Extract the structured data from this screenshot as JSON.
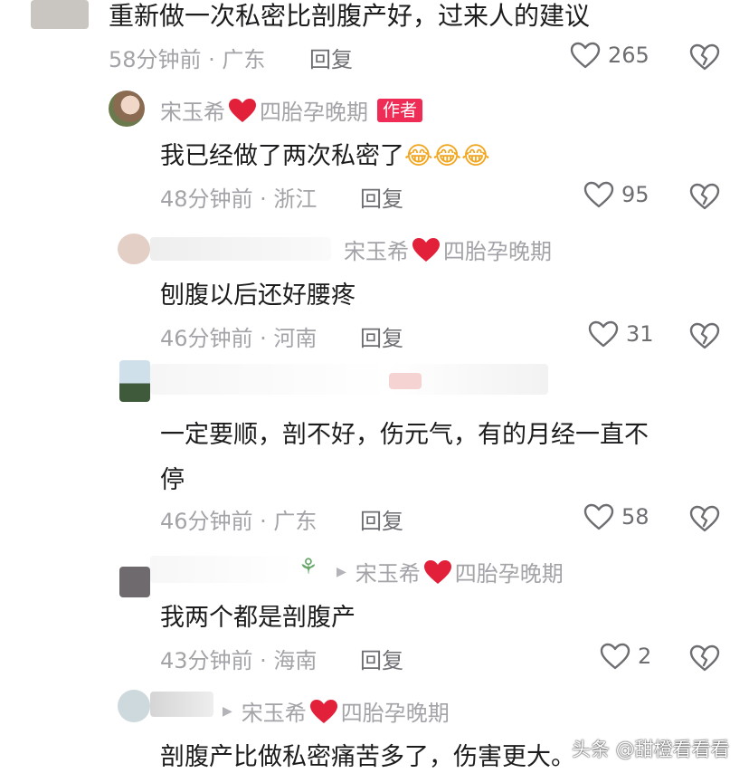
{
  "comments": [
    {
      "text": "重新做一次私密比剖腹产好，过来人的建议",
      "time_location": "58分钟前 · 广东",
      "reply": "回复",
      "likes": "265"
    },
    {
      "author": "宋玉希",
      "author_suffix": "四胎孕晚期",
      "badge": "作者",
      "text": "我已经做了两次私密了",
      "emoji": "😂😂😂",
      "time_location": "48分钟前 · 浙江",
      "reply": "回复",
      "likes": "95"
    },
    {
      "reply_to": "宋玉希",
      "reply_to_suffix": "四胎孕晚期",
      "text": "刨腹以后还好腰疼",
      "time_location": "46分钟前 · 河南",
      "reply": "回复",
      "likes": "31"
    },
    {
      "text_line1": "一定要顺，剖不好，伤元气，有的月经一直不",
      "text_line2": "停",
      "time_location": "46分钟前 · 广东",
      "reply": "回复",
      "likes": "58"
    },
    {
      "reply_to": "宋玉希",
      "reply_to_suffix": "四胎孕晚期",
      "text": "我两个都是剖腹产",
      "time_location": "43分钟前 · 海南",
      "reply": "回复",
      "likes": "2"
    },
    {
      "reply_to": "宋玉希",
      "reply_to_suffix": "四胎孕晚期",
      "text": "剖腹产比做私密痛苦多了，伤害更大。"
    }
  ],
  "watermark": "头条 @甜橙看看看",
  "colors": {
    "accent": "#ee2c55",
    "meta": "#a3a3a8"
  },
  "icons": [
    "heart-outline-icon",
    "dislike-heart-icon",
    "red-heart-icon",
    "reply-arrow-icon"
  ]
}
